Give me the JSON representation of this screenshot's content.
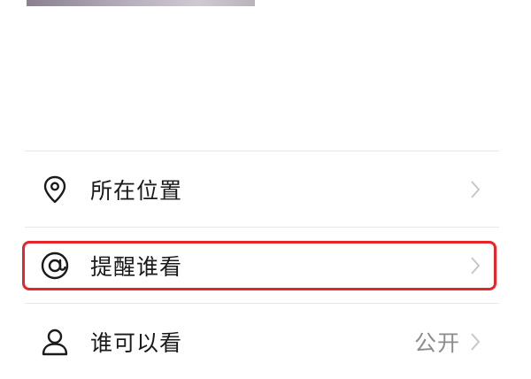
{
  "settings": {
    "items": [
      {
        "label": "所在位置",
        "value": "",
        "icon": "location-pin-icon"
      },
      {
        "label": "提醒谁看",
        "value": "",
        "icon": "at-sign-icon"
      },
      {
        "label": "谁可以看",
        "value": "公开",
        "icon": "person-icon"
      }
    ]
  },
  "colors": {
    "highlight": "#e8242b",
    "divider": "#e8e8e8",
    "label": "#1a1a1a",
    "value": "#8c8c8c",
    "chevron": "#c7c7c7"
  }
}
